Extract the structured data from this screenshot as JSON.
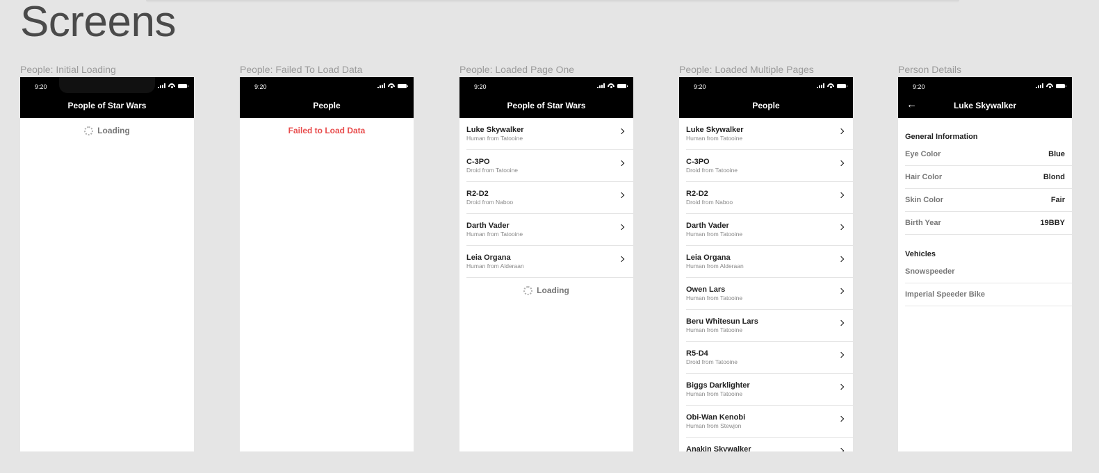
{
  "page": {
    "title": "Screens"
  },
  "status_time": "9:20",
  "frames": [
    {
      "label": "People: Initial Loading",
      "nav_title": "People of Star Wars",
      "loading_text": "Loading"
    },
    {
      "label": "People: Failed To Load Data",
      "nav_title": "People",
      "error_text": "Failed to Load Data"
    },
    {
      "label": "People: Loaded Page One",
      "nav_title": "People of Star Wars",
      "loading_text": "Loading",
      "people": [
        {
          "name": "Luke Skywalker",
          "subtitle": "Human from Tatooine"
        },
        {
          "name": "C-3PO",
          "subtitle": "Droid from Tatooine"
        },
        {
          "name": "R2-D2",
          "subtitle": "Droid from Naboo"
        },
        {
          "name": "Darth Vader",
          "subtitle": "Human from Tatooine"
        },
        {
          "name": "Leia Organa",
          "subtitle": "Human from Alderaan"
        }
      ]
    },
    {
      "label": "People: Loaded Multiple Pages",
      "nav_title": "People",
      "people": [
        {
          "name": "Luke Skywalker",
          "subtitle": "Human from Tatooine"
        },
        {
          "name": "C-3PO",
          "subtitle": "Droid from Tatooine"
        },
        {
          "name": "R2-D2",
          "subtitle": "Droid from Naboo"
        },
        {
          "name": "Darth Vader",
          "subtitle": "Human from Tatooine"
        },
        {
          "name": "Leia Organa",
          "subtitle": "Human from Alderaan"
        },
        {
          "name": "Owen Lars",
          "subtitle": "Human from Tatooine"
        },
        {
          "name": "Beru Whitesun Lars",
          "subtitle": "Human from Tatooine"
        },
        {
          "name": "R5-D4",
          "subtitle": "Droid from Tatooine"
        },
        {
          "name": "Biggs Darklighter",
          "subtitle": "Human from Tatooine"
        },
        {
          "name": "Obi-Wan Kenobi",
          "subtitle": "Human from Stewjon"
        },
        {
          "name": "Anakin Skywalker",
          "subtitle": ""
        }
      ]
    },
    {
      "label": "Person Details",
      "nav_title": "Luke Skywalker",
      "general_title": "General Information",
      "details": [
        {
          "label": "Eye Color",
          "value": "Blue"
        },
        {
          "label": "Hair Color",
          "value": "Blond"
        },
        {
          "label": "Skin Color",
          "value": "Fair"
        },
        {
          "label": "Birth Year",
          "value": "19BBY"
        }
      ],
      "vehicles_title": "Vehicles",
      "vehicles": [
        "Snowspeeder",
        "Imperial Speeder Bike"
      ]
    }
  ],
  "colors": {
    "error": "#e84c4c",
    "navbar": "#000000",
    "background": "#e5e5e5"
  },
  "icons": {
    "back": "arrow-left-icon",
    "row": "chevron-right-icon",
    "loading": "spinner-icon"
  }
}
